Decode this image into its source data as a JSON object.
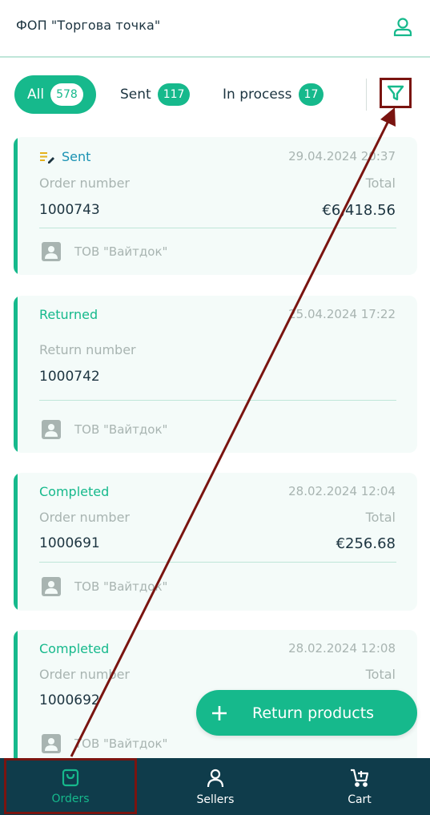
{
  "header": {
    "title": "ФОП \"Торгова точка\"",
    "profile_icon": "user-icon"
  },
  "tabs": [
    {
      "label": "All",
      "count": "578",
      "active": true
    },
    {
      "label": "Sent",
      "count": "117",
      "active": false
    },
    {
      "label": "In process",
      "count": "17",
      "active": false
    }
  ],
  "filter": {
    "icon": "filter-icon"
  },
  "orders": [
    {
      "status": "Sent",
      "status_icon": "edit-list-icon",
      "date": "29.04.2024 20:37",
      "number_label": "Order number",
      "total_label": "Total",
      "number": "1000743",
      "total": "€6,418.56",
      "seller": "ТОВ \"Вайтдок\""
    },
    {
      "status": "Returned",
      "date": "25.04.2024 17:22",
      "number_label": "Return number",
      "number": "1000742",
      "seller": "ТОВ \"Вайтдок\""
    },
    {
      "status": "Completed",
      "date": "28.02.2024 12:04",
      "number_label": "Order number",
      "total_label": "Total",
      "number": "1000691",
      "total": "€256.68",
      "seller": "ТОВ \"Вайтдок\""
    },
    {
      "status": "Completed",
      "date": "28.02.2024 12:08",
      "number_label": "Order number",
      "total_label": "Total",
      "number": "1000692",
      "seller": "ТОВ \"Вайтдок\""
    }
  ],
  "fab": {
    "label": "Return products",
    "icon": "plus-icon"
  },
  "nav": [
    {
      "label": "Orders",
      "icon": "shopping-bag-icon",
      "active": true
    },
    {
      "label": "Sellers",
      "icon": "person-icon",
      "active": false
    },
    {
      "label": "Cart",
      "icon": "cart-icon",
      "active": false
    }
  ],
  "colors": {
    "accent": "#16b98c",
    "nav_bg": "#0f3c4b",
    "annotation": "#7a1410",
    "sent_status": "#1a92b3"
  }
}
